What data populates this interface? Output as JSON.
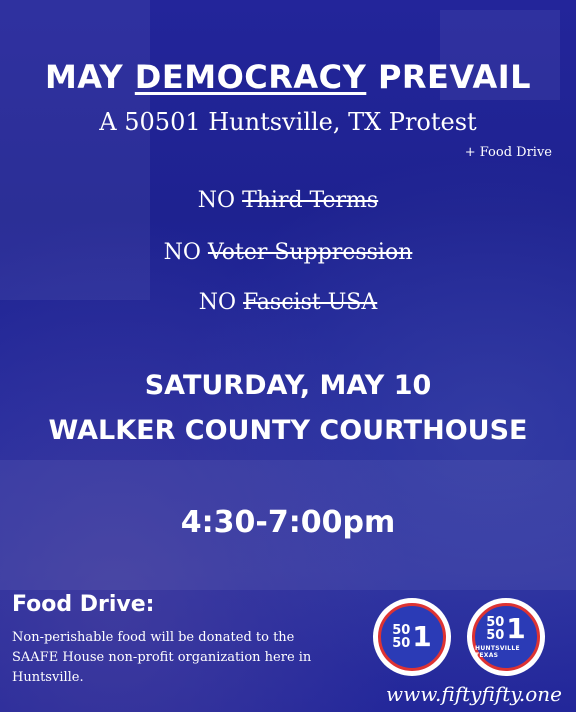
{
  "title": {
    "part1": "MAY ",
    "part2": "DEMOCRACY",
    "part3": " PREVAIL"
  },
  "subtitle": "A 50501 Huntsville, TX Protest",
  "food_tag": "+ Food Drive",
  "no_items": [
    {
      "prefix": "NO ",
      "text": "Third Terms"
    },
    {
      "prefix": "NO ",
      "text": "Voter Suppression"
    },
    {
      "prefix": "NO ",
      "text": "Fascist USA"
    }
  ],
  "event": {
    "date": "SATURDAY, MAY 10",
    "location": "WALKER COUNTY COURTHOUSE",
    "time": "4:30-7:00pm"
  },
  "food_drive": {
    "heading": "Food Drive:",
    "body": "Non-perishable food will be donated to the SAAFE House non-profit organization here in Huntsville."
  },
  "logos": [
    {
      "top": "50",
      "bottom": "50",
      "big": "1",
      "caption": ""
    },
    {
      "top": "50",
      "bottom": "50",
      "big": "1",
      "caption": "HUNTSVILLE TEXAS"
    }
  ],
  "website": "www.fiftyfifty.one",
  "colors": {
    "background": "#1e2290",
    "text": "#ffffff",
    "logo_blue": "#2b3bb6",
    "logo_ring": "#dd3333"
  }
}
